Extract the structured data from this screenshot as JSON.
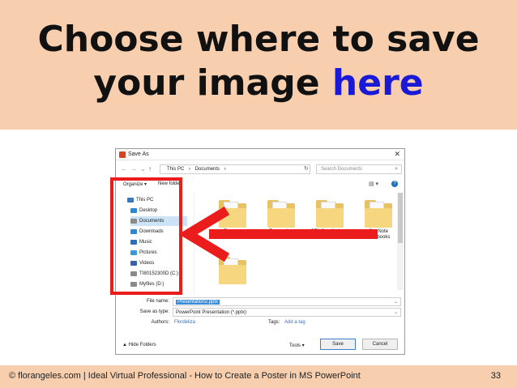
{
  "slide": {
    "title_line1": "Choose where to save",
    "title_line2_plain": "your image ",
    "title_line2_highlight": "here",
    "highlight_color": "#1a1ad6",
    "band_color": "#f8cfae",
    "annotation_color": "#ea1c1c"
  },
  "dialog": {
    "title": "Save As",
    "close": "✕",
    "address_segments": [
      "This PC",
      "›",
      "Documents",
      "›"
    ],
    "search_placeholder": "Search Documents",
    "organize_label": "Organize ▾",
    "new_folder_label": "New folder",
    "nav_items": [
      {
        "label": "This PC",
        "icon": "computer-icon",
        "color": "#3b78c2"
      },
      {
        "label": "Desktop",
        "icon": "desktop-icon",
        "color": "#2f86d4"
      },
      {
        "label": "Documents",
        "icon": "documents-icon",
        "color": "#8a8a8a",
        "selected": true
      },
      {
        "label": "Downloads",
        "icon": "downloads-icon",
        "color": "#2f86d4"
      },
      {
        "label": "Music",
        "icon": "music-icon",
        "color": "#2f6fb8"
      },
      {
        "label": "Pictures",
        "icon": "pictures-icon",
        "color": "#3f97d9"
      },
      {
        "label": "Videos",
        "icon": "videos-icon",
        "color": "#3a5fa8"
      },
      {
        "label": "TI80152300D (C:)",
        "icon": "drive-icon",
        "color": "#8a8a8a"
      },
      {
        "label": "Myfiles (D:)",
        "icon": "drive-icon",
        "color": "#8a8a8a"
      }
    ],
    "folders": [
      {
        "label": "Express"
      },
      {
        "label": "Expression"
      },
      {
        "label": "GTA San Andreas User Files"
      },
      {
        "label": "OneNote Notebooks"
      },
      {
        "label": ""
      }
    ],
    "file_name_label": "File name:",
    "file_name_value": "Presentation2.pptx",
    "save_as_type_label": "Save as type:",
    "save_as_type_value": "PowerPoint Presentation (*.pptx)",
    "authors_label": "Authors:",
    "authors_value": "Flordeliza",
    "tags_label": "Tags:",
    "tags_value": "Add a tag",
    "hide_folders_label": "▲ Hide Folders",
    "tools_label": "Tools ▾",
    "save_label": "Save",
    "cancel_label": "Cancel"
  },
  "footer": {
    "text": "© florangeles.com  | Ideal Virtual Professional - How to Create a Poster in MS PowerPoint",
    "page": "33"
  }
}
